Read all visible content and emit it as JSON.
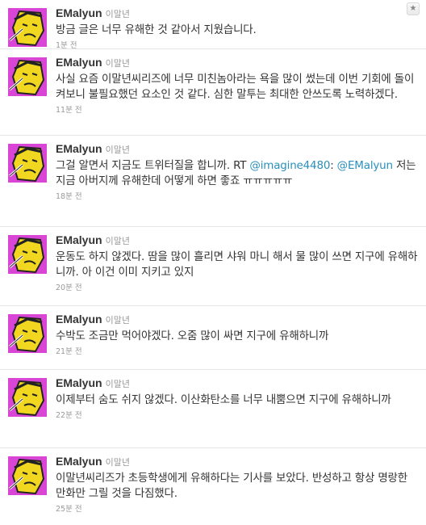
{
  "tweets": [
    {
      "screen_name": "EMalyun",
      "real_name": "이말년",
      "text": "방금 글은 너무 유해한 것 같아서 지웠습니다.",
      "time": "1분 전",
      "has_action_button": true
    },
    {
      "screen_name": "EMalyun",
      "real_name": "이말년",
      "text": "사실 요즘 이말년씨리즈에 너무 미친놈아라는 욕을 많이 썼는데 이번 기회에 돌이켜보니 불필요했던 요소인 것 같다. 심한 말투는 최대한 안쓰도록 노력하겠다.",
      "time": "11분 전"
    },
    {
      "screen_name": "EMalyun",
      "real_name": "이말년",
      "text_before": "그걸 알면서 지금도 트위터질을 합니까. RT ",
      "mention1": "@imagine4480",
      "text_mid": ": ",
      "mention2": "@EMalyun",
      "text_after": " 저는 지금 아버지께 유해한데 어떻게 하면 좋죠 ㅠㅠㅠㅠㅠ",
      "time": "18분 전"
    },
    {
      "screen_name": "EMalyun",
      "real_name": "이말년",
      "text": "운동도 하지 않겠다. 땀을 많이 흘리면 샤워 마니 해서 물 많이 쓰면 지구에 유해하니까. 아 이건 이미 지키고 있지",
      "time": "20분 전"
    },
    {
      "screen_name": "EMalyun",
      "real_name": "이말년",
      "text": "수박도 조금만 먹어야겠다. 오줌 많이 싸면 지구에 유해하니까",
      "time": "21분 전"
    },
    {
      "screen_name": "EMalyun",
      "real_name": "이말년",
      "text": "이제부터 숨도 쉬지 않겠다. 이산화탄소를 너무 내뿜으면 지구에 유해하니까",
      "time": "22분 전"
    },
    {
      "screen_name": "EMalyun",
      "real_name": "이말년",
      "text": "이말년씨리즈가 초등학생에게 유해하다는 기사를 보았다. 반성하고 항상 명랑한 만화만 그릴 것을 다짐했다.",
      "time": "25분 전"
    }
  ],
  "colors": {
    "avatar_bg": "#d946d6",
    "link": "#2a8fbd",
    "meta": "#999999"
  },
  "icons": {
    "action": "star-icon"
  }
}
